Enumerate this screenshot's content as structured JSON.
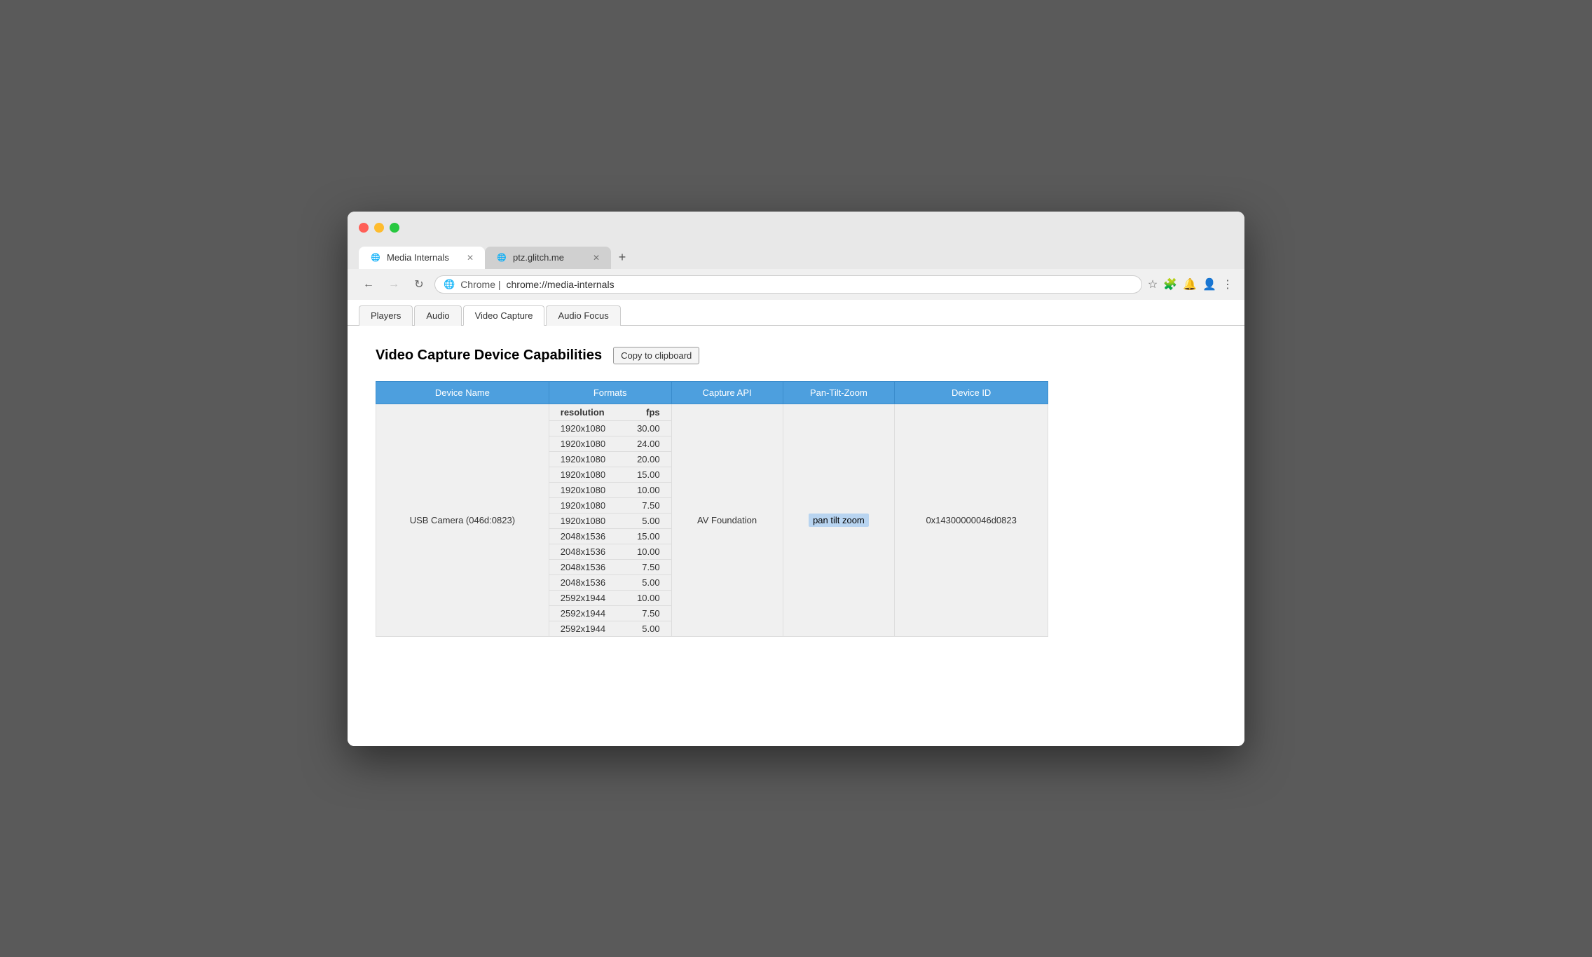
{
  "browser": {
    "tabs": [
      {
        "id": "media-internals",
        "label": "Media Internals",
        "icon": "🌐",
        "active": true,
        "closable": true
      },
      {
        "id": "ptz-glitch",
        "label": "ptz.glitch.me",
        "icon": "🌐",
        "active": false,
        "closable": true
      }
    ],
    "new_tab_label": "+",
    "back_disabled": false,
    "forward_disabled": true,
    "url_prefix": "Chrome | ",
    "url": "chrome://media-internals",
    "nav": {
      "back": "←",
      "forward": "→",
      "reload": "↻"
    }
  },
  "page": {
    "tabs": [
      {
        "id": "players",
        "label": "Players",
        "active": false
      },
      {
        "id": "audio",
        "label": "Audio",
        "active": false
      },
      {
        "id": "video-capture",
        "label": "Video Capture",
        "active": true
      },
      {
        "id": "audio-focus",
        "label": "Audio Focus",
        "active": false
      }
    ],
    "section": {
      "title": "Video Capture Device Capabilities",
      "clipboard_btn": "Copy to clipboard"
    },
    "table": {
      "headers": [
        "Device Name",
        "Formats",
        "Capture API",
        "Pan-Tilt-Zoom",
        "Device ID"
      ],
      "formats_sub_headers": [
        "resolution",
        "fps"
      ],
      "rows": [
        {
          "device_name": "USB Camera (046d:0823)",
          "formats": [
            {
              "resolution": "1920x1080",
              "fps": "30.00"
            },
            {
              "resolution": "1920x1080",
              "fps": "24.00"
            },
            {
              "resolution": "1920x1080",
              "fps": "20.00"
            },
            {
              "resolution": "1920x1080",
              "fps": "15.00"
            },
            {
              "resolution": "1920x1080",
              "fps": "10.00"
            },
            {
              "resolution": "1920x1080",
              "fps": "7.50"
            },
            {
              "resolution": "1920x1080",
              "fps": "5.00"
            },
            {
              "resolution": "2048x1536",
              "fps": "15.00"
            },
            {
              "resolution": "2048x1536",
              "fps": "10.00"
            },
            {
              "resolution": "2048x1536",
              "fps": "7.50"
            },
            {
              "resolution": "2048x1536",
              "fps": "5.00"
            },
            {
              "resolution": "2592x1944",
              "fps": "10.00"
            },
            {
              "resolution": "2592x1944",
              "fps": "7.50"
            },
            {
              "resolution": "2592x1944",
              "fps": "5.00"
            }
          ],
          "capture_api": "AV Foundation",
          "ptz": "pan tilt zoom",
          "device_id": "0x14300000046d0823"
        }
      ]
    }
  }
}
